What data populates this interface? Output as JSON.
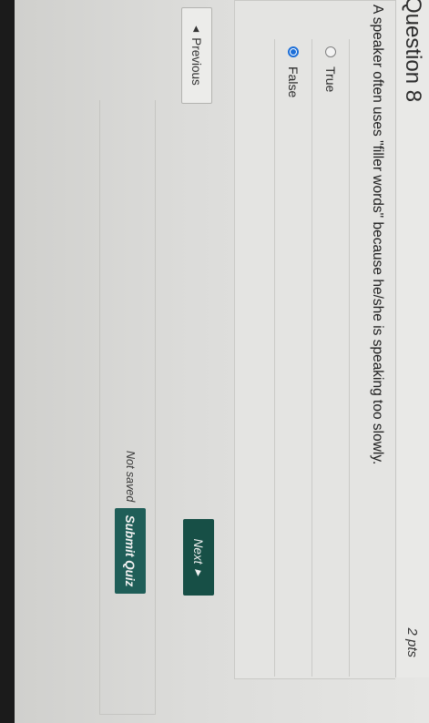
{
  "question": {
    "title": "Question 8",
    "points": "2 pts",
    "text": "A speaker often uses \"filler words\" because he/she is speaking too slowly.",
    "answers": [
      {
        "label": "True",
        "selected": false
      },
      {
        "label": "False",
        "selected": true
      }
    ]
  },
  "nav": {
    "previous_label": "Previous",
    "next_label": "Next",
    "left_arrow": "◀",
    "right_arrow": "▶"
  },
  "footer": {
    "status": "Not saved",
    "submit_label": "Submit Quiz"
  },
  "colors": {
    "accent_button": "#174f46",
    "radio_selected": "#1d6fd8"
  }
}
